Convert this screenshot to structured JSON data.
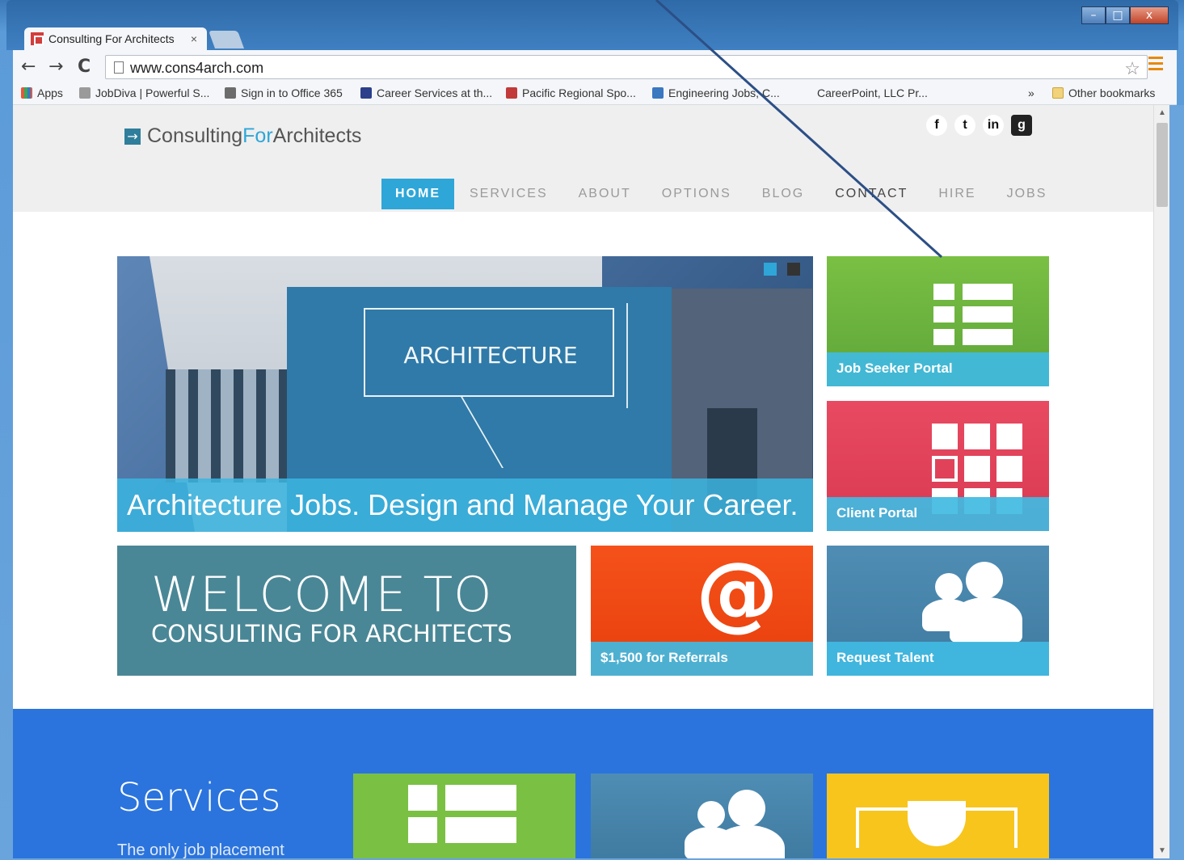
{
  "browser": {
    "tab_title": "Consulting For Architects",
    "tab_close": "×",
    "url": "www.cons4arch.com",
    "window_controls": [
      "–",
      "□",
      "x"
    ],
    "nav_back": "←",
    "nav_forward": "→",
    "nav_reload": "C",
    "star": "☆",
    "bookmarks": [
      {
        "label": "Apps",
        "icon": "apps-grid-icon",
        "color": "#e2593b"
      },
      {
        "label": "JobDiva | Powerful S...",
        "icon": "jobdiva-icon",
        "color": "#9a9a9a"
      },
      {
        "label": "Sign in to Office 365",
        "icon": "office-icon",
        "color": "#6c6c6c"
      },
      {
        "label": "Career Services at th...",
        "icon": "shield-icon",
        "color": "#2b3f8a"
      },
      {
        "label": "Pacific Regional Spo...",
        "icon": "bookmark-icon",
        "color": "#c23a3a"
      },
      {
        "label": "Engineering Jobs, C...",
        "icon": "engineering-icon",
        "color": "#3a78c0"
      },
      {
        "label": "CareerPoint, LLC Pr...",
        "icon": "",
        "color": ""
      }
    ],
    "bookmarks_overflow": "»",
    "other_bookmarks": "Other bookmarks"
  },
  "site": {
    "logo_prefix": "Consulting",
    "logo_accent": "For",
    "logo_suffix": "Architects",
    "logo_mark": "→",
    "social": [
      "f",
      "t",
      "in",
      "g"
    ],
    "nav": [
      "HOME",
      "SERVICES",
      "ABOUT",
      "OPTIONS",
      "BLOG",
      "CONTACT",
      "HIRE",
      "JOBS"
    ],
    "active_nav": "HOME",
    "hero": {
      "board_text": "ARCHITECTURE",
      "caption": "Architecture Jobs. Design and Manage Your Career.",
      "slides": 2,
      "active_slide": 1
    },
    "tiles": {
      "job_seeker": "Job Seeker Portal",
      "client": "Client Portal",
      "welcome_big": "WELCOME TO",
      "welcome_small": "CONSULTING FOR ARCHITECTS",
      "referrals": "$1,500 for Referrals",
      "referrals_symbol": "@",
      "request": "Request Talent"
    },
    "services": {
      "title": "Services",
      "subtitle": "The only job placement"
    }
  },
  "colors": {
    "accent_blue": "#2ea6d8",
    "green": "#7ac043",
    "red": "#e84a62",
    "orange": "#f5511a",
    "teal": "#4a8796",
    "services_blue": "#2b74dd",
    "yellow": "#f7c51c"
  }
}
